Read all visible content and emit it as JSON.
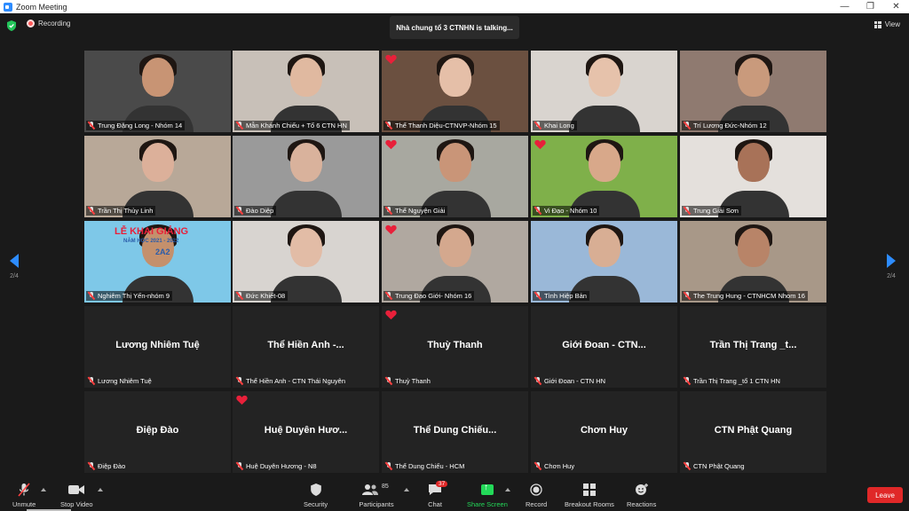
{
  "window": {
    "title": "Zoom Meeting",
    "minimize": "—",
    "restore": "❐",
    "close": "✕"
  },
  "top": {
    "recording": "Recording",
    "talking": "Nhà chung tổ 3 CTNHN is talking...",
    "view": "View"
  },
  "pager": {
    "left": "2/4",
    "right": "2/4"
  },
  "tiles": [
    {
      "name": "Trung Đặng Long - Nhóm 14",
      "video": true,
      "heart": false,
      "bg": "#4a4a4a",
      "skin": "#c89474"
    },
    {
      "name": "Mẫn Khánh Chiếu + Tổ 6 CTN HN",
      "video": true,
      "heart": false,
      "bg": "#c8c0b8",
      "skin": "#e0b9a0"
    },
    {
      "name": "Thể Thanh Diệu-CTNVP-Nhóm 15",
      "video": true,
      "heart": true,
      "bg": "#6b5040",
      "skin": "#e5bfa8"
    },
    {
      "name": "Khai Long",
      "video": true,
      "heart": false,
      "bg": "#d9d4cf",
      "skin": "#e6c2ab"
    },
    {
      "name": "Trí Lương Đức-Nhóm 12",
      "video": true,
      "heart": false,
      "bg": "#8f7a70",
      "skin": "#c99a7c"
    },
    {
      "name": "Trần Thị Thủy Linh",
      "video": true,
      "heart": false,
      "bg": "#b8a898",
      "skin": "#dcb09a"
    },
    {
      "name": "Đào Diệp",
      "video": true,
      "heart": false,
      "bg": "#9a9a9a",
      "skin": "#d9b29c"
    },
    {
      "name": "Thể Nguyện Giải",
      "video": true,
      "heart": true,
      "bg": "#a8a8a0",
      "skin": "#c99578"
    },
    {
      "name": "Vi Đạo - Nhóm 10",
      "video": true,
      "heart": true,
      "bg": "#7fb04a",
      "skin": "#d8a88a"
    },
    {
      "name": "Trung Giải Sơn",
      "video": true,
      "heart": false,
      "bg": "#e4e0dc",
      "skin": "#a87258"
    },
    {
      "name": "Nghiêm Thị Yến-nhóm 9",
      "video": true,
      "heart": false,
      "bg": "#7ec8e8",
      "skin": "#c4906c"
    },
    {
      "name": "Đức Khiết-08",
      "video": true,
      "heart": false,
      "bg": "#d8d4d0",
      "skin": "#e2bca6"
    },
    {
      "name": "Trung Đạo Giới- Nhóm 16",
      "video": true,
      "heart": true,
      "bg": "#b0a8a0",
      "skin": "#d4a88e"
    },
    {
      "name": "Tình Hiệp Bản",
      "video": true,
      "heart": false,
      "bg": "#9ab8d8",
      "skin": "#d8ae94"
    },
    {
      "name": "The Trung Hung - CTNHCM Nhom 16",
      "video": true,
      "heart": false,
      "bg": "#a89888",
      "skin": "#b88468"
    },
    {
      "name": "Lương Nhiêm Tuệ",
      "big": "Lương Nhiêm Tuệ",
      "video": false,
      "heart": false
    },
    {
      "name": "Thể Hiền Anh - CTN Thái Nguyên",
      "big": "Thể Hiền Anh -...",
      "video": false,
      "heart": false
    },
    {
      "name": "Thuỳ Thanh",
      "big": "Thuỳ Thanh",
      "video": false,
      "heart": true
    },
    {
      "name": "Giới Đoan - CTN HN",
      "big": "Giới Đoan - CTN...",
      "video": false,
      "heart": false
    },
    {
      "name": "Trần Thị Trang _tổ 1 CTN HN",
      "big": "Trần Thị Trang _t...",
      "video": false,
      "heart": false
    },
    {
      "name": "Điệp Đào",
      "big": "Điệp Đào",
      "video": false,
      "heart": false
    },
    {
      "name": "Huệ Duyên Hương - N8",
      "big": "Huệ Duyên Hươ...",
      "video": false,
      "heart": true
    },
    {
      "name": "Thể Dung Chiếu - HCM",
      "big": "Thể Dung Chiếu...",
      "video": false,
      "heart": false
    },
    {
      "name": "Chơn Huy",
      "big": "Chơn Huy",
      "video": false,
      "heart": false
    },
    {
      "name": "CTN Phật Quang",
      "big": "CTN Phật Quang",
      "video": false,
      "heart": false
    }
  ],
  "sign": {
    "l1": "LỄ KHAI GIẢNG",
    "l2": "NĂM HỌC 2021 - 2022",
    "l3": "2A2"
  },
  "toolbar": {
    "unmute": "Unmute",
    "stop_video": "Stop Video",
    "security": "Security",
    "participants": "Participants",
    "participants_count": "85",
    "chat": "Chat",
    "chat_badge": "37",
    "share": "Share Screen",
    "record": "Record",
    "breakout": "Breakout Rooms",
    "reactions": "Reactions",
    "leave": "Leave"
  },
  "colors": {
    "accent": "#2d8cff",
    "leave": "#e02828",
    "share": "#23d959",
    "heart": "#e8203a"
  }
}
